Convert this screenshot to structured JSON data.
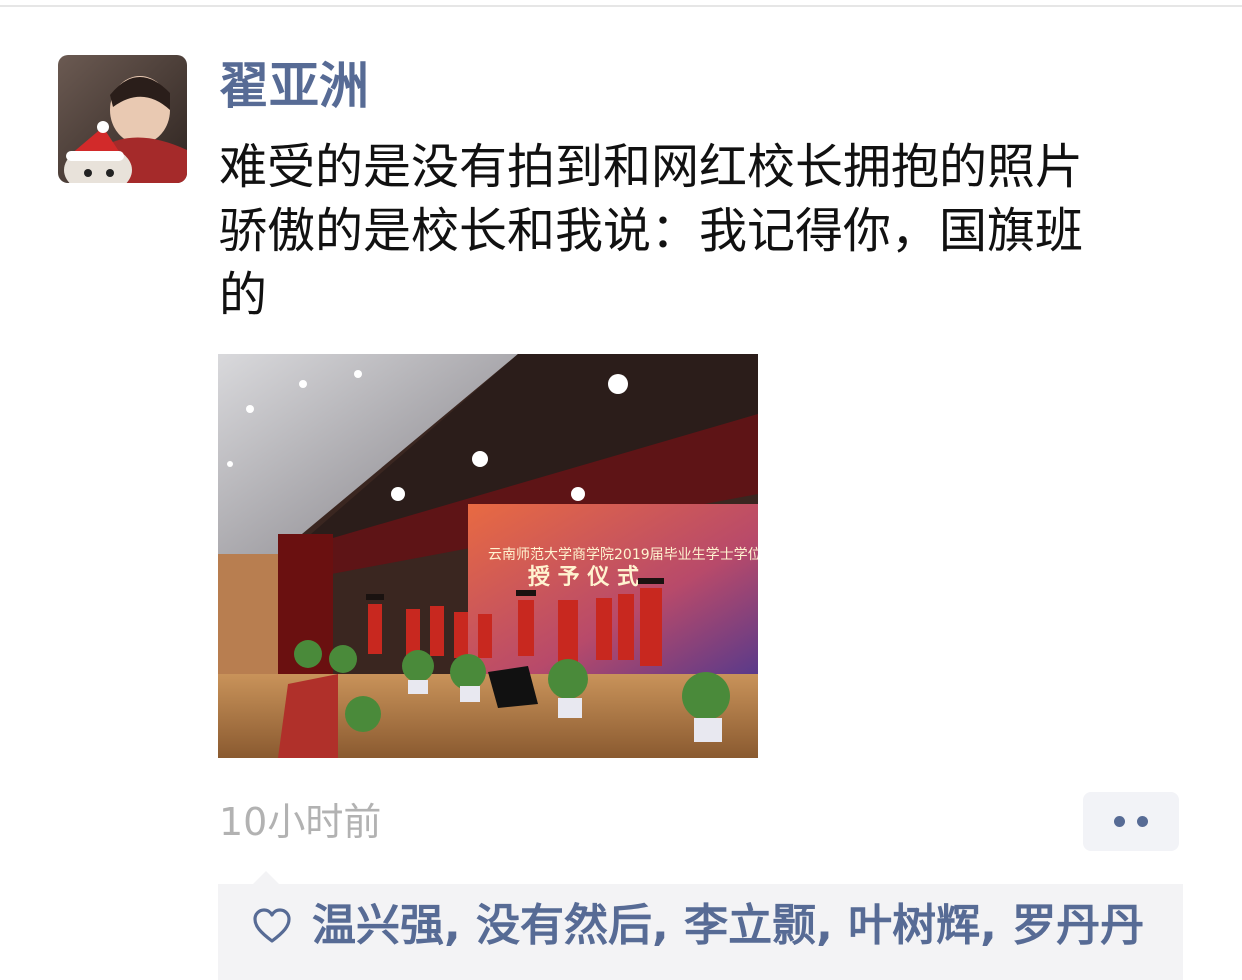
{
  "post": {
    "author": "翟亚洲",
    "text": "难受的是没有拍到和网红校长拥抱的照片\n骄傲的是校长和我说：我记得你，国旗班\n的",
    "photo": {
      "banner_line1": "云南师范大学商学院2019届毕业生学士学位",
      "banner_line2": "授 予 仪 式"
    },
    "time": "10小时前"
  },
  "likes": {
    "icon": "heart-outline-icon",
    "names": [
      "温兴强",
      "没有然后",
      "李立颢",
      "叶树辉",
      "罗丹丹"
    ],
    "separator": ", "
  },
  "colors": {
    "link": "#576b95",
    "text": "#111111",
    "muted": "#b2b2b2",
    "panel": "#f3f3f5"
  }
}
